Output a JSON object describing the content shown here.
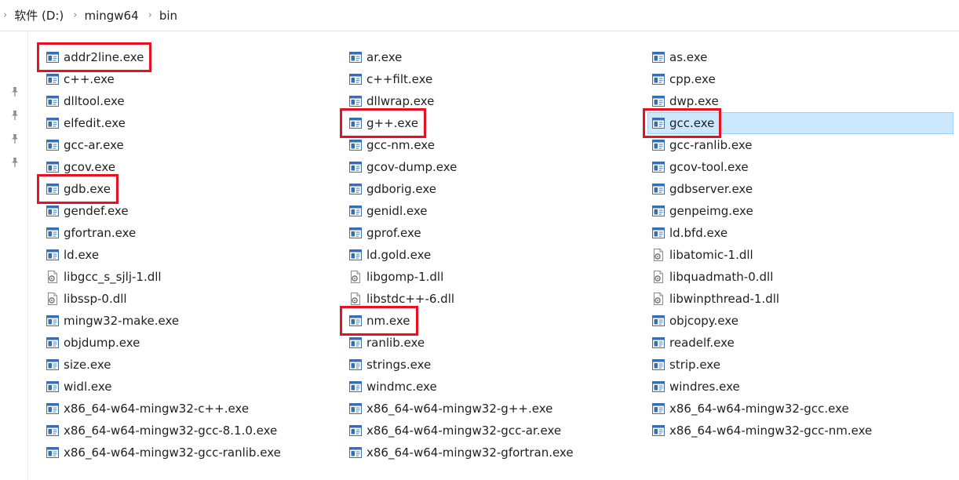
{
  "breadcrumb": {
    "items": [
      "软件 (D:)",
      "mingw64",
      "bin"
    ]
  },
  "columns": [
    [
      {
        "name": "addr2line.exe",
        "type": "exe",
        "highlighted": true
      },
      {
        "name": "c++.exe",
        "type": "exe"
      },
      {
        "name": "dlltool.exe",
        "type": "exe"
      },
      {
        "name": "elfedit.exe",
        "type": "exe"
      },
      {
        "name": "gcc-ar.exe",
        "type": "exe"
      },
      {
        "name": "gcov.exe",
        "type": "exe"
      },
      {
        "name": "gdb.exe",
        "type": "exe",
        "highlighted": true
      },
      {
        "name": "gendef.exe",
        "type": "exe"
      },
      {
        "name": "gfortran.exe",
        "type": "exe"
      },
      {
        "name": "ld.exe",
        "type": "exe"
      },
      {
        "name": "libgcc_s_sjlj-1.dll",
        "type": "dll"
      },
      {
        "name": "libssp-0.dll",
        "type": "dll"
      },
      {
        "name": "mingw32-make.exe",
        "type": "exe"
      },
      {
        "name": "objdump.exe",
        "type": "exe"
      },
      {
        "name": "size.exe",
        "type": "exe"
      },
      {
        "name": "widl.exe",
        "type": "exe"
      },
      {
        "name": "x86_64-w64-mingw32-c++.exe",
        "type": "exe"
      },
      {
        "name": "x86_64-w64-mingw32-gcc-8.1.0.exe",
        "type": "exe"
      },
      {
        "name": "x86_64-w64-mingw32-gcc-ranlib.exe",
        "type": "exe"
      }
    ],
    [
      {
        "name": "ar.exe",
        "type": "exe"
      },
      {
        "name": "c++filt.exe",
        "type": "exe"
      },
      {
        "name": "dllwrap.exe",
        "type": "exe"
      },
      {
        "name": "g++.exe",
        "type": "exe",
        "highlighted": true
      },
      {
        "name": "gcc-nm.exe",
        "type": "exe"
      },
      {
        "name": "gcov-dump.exe",
        "type": "exe"
      },
      {
        "name": "gdborig.exe",
        "type": "exe"
      },
      {
        "name": "genidl.exe",
        "type": "exe"
      },
      {
        "name": "gprof.exe",
        "type": "exe"
      },
      {
        "name": "ld.gold.exe",
        "type": "exe"
      },
      {
        "name": "libgomp-1.dll",
        "type": "dll"
      },
      {
        "name": "libstdc++-6.dll",
        "type": "dll"
      },
      {
        "name": "nm.exe",
        "type": "exe",
        "highlighted": true
      },
      {
        "name": "ranlib.exe",
        "type": "exe"
      },
      {
        "name": "strings.exe",
        "type": "exe"
      },
      {
        "name": "windmc.exe",
        "type": "exe"
      },
      {
        "name": "x86_64-w64-mingw32-g++.exe",
        "type": "exe"
      },
      {
        "name": "x86_64-w64-mingw32-gcc-ar.exe",
        "type": "exe"
      },
      {
        "name": "x86_64-w64-mingw32-gfortran.exe",
        "type": "exe"
      }
    ],
    [
      {
        "name": "as.exe",
        "type": "exe"
      },
      {
        "name": "cpp.exe",
        "type": "exe"
      },
      {
        "name": "dwp.exe",
        "type": "exe"
      },
      {
        "name": "gcc.exe",
        "type": "exe",
        "highlighted": true,
        "selected": true
      },
      {
        "name": "gcc-ranlib.exe",
        "type": "exe"
      },
      {
        "name": "gcov-tool.exe",
        "type": "exe"
      },
      {
        "name": "gdbserver.exe",
        "type": "exe"
      },
      {
        "name": "genpeimg.exe",
        "type": "exe"
      },
      {
        "name": "ld.bfd.exe",
        "type": "exe"
      },
      {
        "name": "libatomic-1.dll",
        "type": "dll"
      },
      {
        "name": "libquadmath-0.dll",
        "type": "dll"
      },
      {
        "name": "libwinpthread-1.dll",
        "type": "dll"
      },
      {
        "name": "objcopy.exe",
        "type": "exe"
      },
      {
        "name": "readelf.exe",
        "type": "exe"
      },
      {
        "name": "strip.exe",
        "type": "exe"
      },
      {
        "name": "windres.exe",
        "type": "exe"
      },
      {
        "name": "x86_64-w64-mingw32-gcc.exe",
        "type": "exe"
      },
      {
        "name": "x86_64-w64-mingw32-gcc-nm.exe",
        "type": "exe"
      }
    ]
  ],
  "colors": {
    "highlight": "#e81123",
    "selection_bg": "#cce8ff",
    "selection_border": "#99d1ff"
  },
  "icons": {
    "exe": "application-window-icon",
    "dll": "dll-settings-file-icon",
    "pin": "pin-icon",
    "separator": "chevron-right-icon"
  }
}
